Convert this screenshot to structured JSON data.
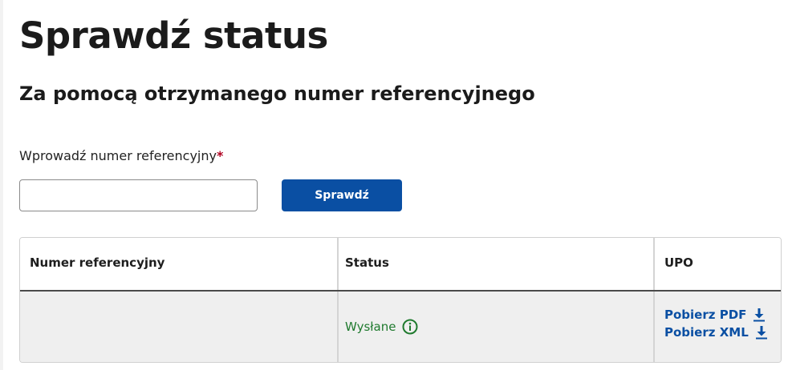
{
  "page": {
    "title": "Sprawdź status",
    "section_title": "Za pomocą otrzymanego numer referencyjnego"
  },
  "form": {
    "label": "Wprowadź numer referencyjny",
    "required_mark": "*",
    "input_value": "",
    "input_placeholder": "",
    "submit_label": "Sprawdź"
  },
  "table": {
    "headers": [
      "Numer referencyjny",
      "Status",
      "UPO"
    ],
    "rows": [
      {
        "reference_number": "",
        "status": "Wysłane",
        "status_icon": "info-circle-icon",
        "upo_links": [
          {
            "label": "Pobierz PDF",
            "icon": "download-icon"
          },
          {
            "label": "Pobierz XML",
            "icon": "download-icon"
          }
        ]
      }
    ]
  },
  "colors": {
    "primary": "#0a4fa3",
    "status_success": "#1f7a2e",
    "required": "#b00020",
    "row_background": "#efefef"
  }
}
